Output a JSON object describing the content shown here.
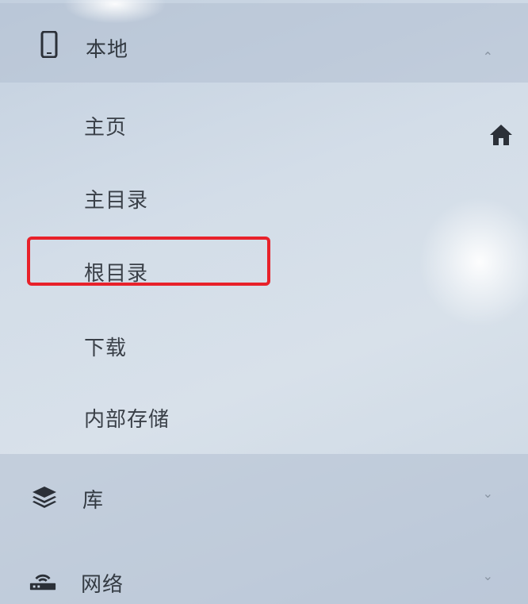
{
  "drawer": {
    "local": {
      "label": "本地",
      "icon": "phone-icon",
      "expanded": true
    },
    "local_items": [
      {
        "label": "主页"
      },
      {
        "label": "主目录"
      },
      {
        "label": "根目录",
        "highlighted": true
      },
      {
        "label": "下载"
      },
      {
        "label": "内部存储"
      }
    ],
    "library": {
      "label": "库",
      "icon": "layers-icon"
    },
    "network": {
      "label": "网络",
      "icon": "router-icon"
    }
  },
  "colors": {
    "highlight": "#e8212a",
    "text": "#3a4048"
  }
}
